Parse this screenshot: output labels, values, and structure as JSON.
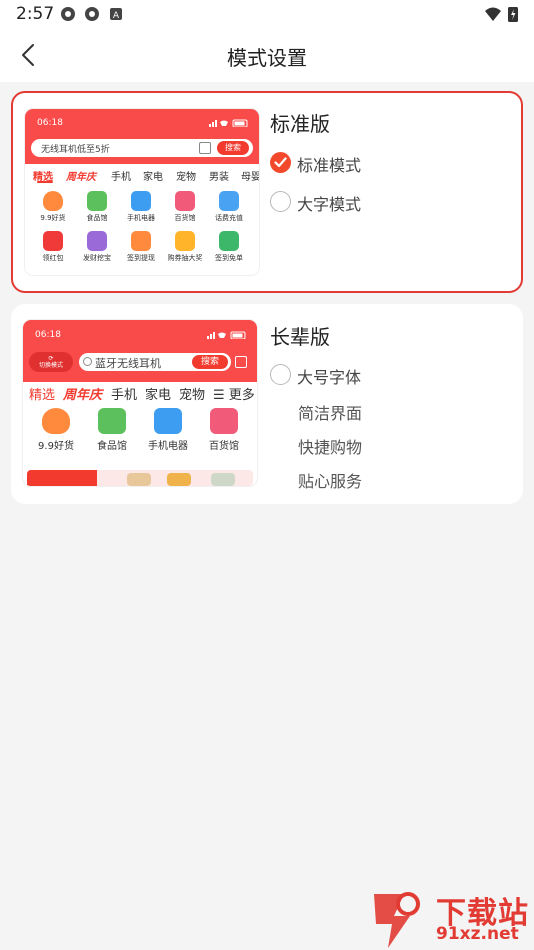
{
  "status_bar": {
    "time": "2:57",
    "icons": [
      "app-notification-icon",
      "app-notification-icon",
      "a-badge-icon",
      "wifi-icon",
      "battery-charging-icon"
    ]
  },
  "header": {
    "title": "模式设置",
    "back_icon": "chevron-left-icon"
  },
  "standard": {
    "title": "标准版",
    "selected": true,
    "options": [
      {
        "label": "标准模式",
        "checked": true
      },
      {
        "label": "大字模式",
        "checked": false
      }
    ],
    "preview": {
      "time": "06:18",
      "search_placeholder": "无线耳机低至5折",
      "search_button": "搜索",
      "tabs": [
        "精选",
        "周年庆",
        "手机",
        "家电",
        "宠物",
        "男装",
        "母婴"
      ],
      "grid": [
        {
          "label": "9.9好货",
          "icon": "fire-icon",
          "color": "#ff8a3d"
        },
        {
          "label": "食品馆",
          "icon": "basket-icon",
          "color": "#5cc05c"
        },
        {
          "label": "手机电器",
          "icon": "3c-icon",
          "color": "#3d9df0"
        },
        {
          "label": "百货馆",
          "icon": "gift-icon",
          "color": "#f25a7a"
        },
        {
          "label": "话费充值",
          "icon": "recharge-icon",
          "color": "#4aa3f2"
        },
        {
          "label": "领红包",
          "icon": "red-packet-icon",
          "color": "#f03a3a"
        },
        {
          "label": "发财挖宝",
          "icon": "shovel-icon",
          "color": "#9a6ad8"
        },
        {
          "label": "签到提现",
          "icon": "checkin-icon",
          "color": "#ff8a3d"
        },
        {
          "label": "购券抽大奖",
          "icon": "coupon-icon",
          "color": "#ffb42a"
        },
        {
          "label": "签到免单",
          "icon": "free-icon",
          "color": "#3db86a"
        }
      ]
    }
  },
  "elder": {
    "title": "长辈版",
    "selected": false,
    "option": {
      "label": "大号字体",
      "checked": false
    },
    "features": [
      "简洁界面",
      "快捷购物",
      "贴心服务"
    ],
    "preview": {
      "time": "06:18",
      "switch_label": "切换模式",
      "search_placeholder": "蓝牙无线耳机",
      "search_button": "搜索",
      "tabs": [
        "精选",
        "周年庆",
        "手机",
        "家电",
        "宠物",
        "☰ 更多"
      ],
      "grid": [
        {
          "label": "9.9好货",
          "icon": "fire-icon",
          "color": "#ff8a3d"
        },
        {
          "label": "食品馆",
          "icon": "basket-icon",
          "color": "#5cc05c"
        },
        {
          "label": "手机电器",
          "icon": "3c-icon",
          "color": "#3d9df0"
        },
        {
          "label": "百货馆",
          "icon": "gift-icon",
          "color": "#f25a7a"
        }
      ]
    }
  },
  "watermark": {
    "text_top": "下载站",
    "text_bottom": "91xz.net"
  },
  "colors": {
    "accent": "#e23b33",
    "preview_red": "#fa4b4b",
    "background": "#f4f4f4"
  }
}
